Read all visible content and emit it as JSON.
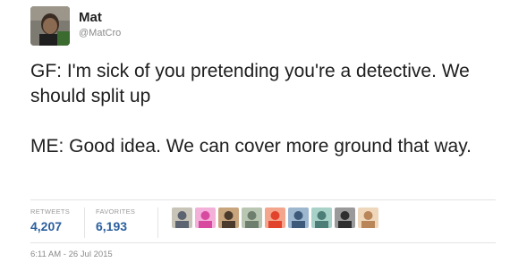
{
  "user": {
    "display_name": "Mat",
    "handle": "@MatCro",
    "avatar_icon": "user-photo"
  },
  "tweet": {
    "paragraphs": [
      "GF: I'm sick of you pretending you're a detective. We should split up",
      "ME: Good idea. We can cover more ground that way."
    ]
  },
  "stats": {
    "retweets_label": "RETWEETS",
    "retweets_count": "4,207",
    "favorites_label": "FAVORITES",
    "favorites_count": "6,193"
  },
  "favoriters": [
    {
      "icon": "favoriter-avatar",
      "colors": [
        "#5b6470",
        "#c9c4b8"
      ]
    },
    {
      "icon": "favoriter-avatar",
      "colors": [
        "#d84aa0",
        "#f3b1d9"
      ]
    },
    {
      "icon": "favoriter-avatar",
      "colors": [
        "#4a3b2c",
        "#c8a57d"
      ]
    },
    {
      "icon": "favoriter-avatar",
      "colors": [
        "#6e7f6e",
        "#b9c6b1"
      ]
    },
    {
      "icon": "favoriter-avatar",
      "colors": [
        "#e2432c",
        "#f4a68d"
      ]
    },
    {
      "icon": "favoriter-avatar",
      "colors": [
        "#3d5a7a",
        "#9db7cf"
      ]
    },
    {
      "icon": "favoriter-avatar",
      "colors": [
        "#4c7d77",
        "#a8d1c8"
      ]
    },
    {
      "icon": "favoriter-avatar",
      "colors": [
        "#2f2f2f",
        "#9a9a9a"
      ]
    },
    {
      "icon": "favoriter-avatar",
      "colors": [
        "#b9865a",
        "#efd7bc"
      ]
    }
  ],
  "timestamp": "6:11 AM - 26 Jul 2015",
  "colors": {
    "count_color": "#2b5f9e",
    "muted_text": "#8a8a8a"
  }
}
